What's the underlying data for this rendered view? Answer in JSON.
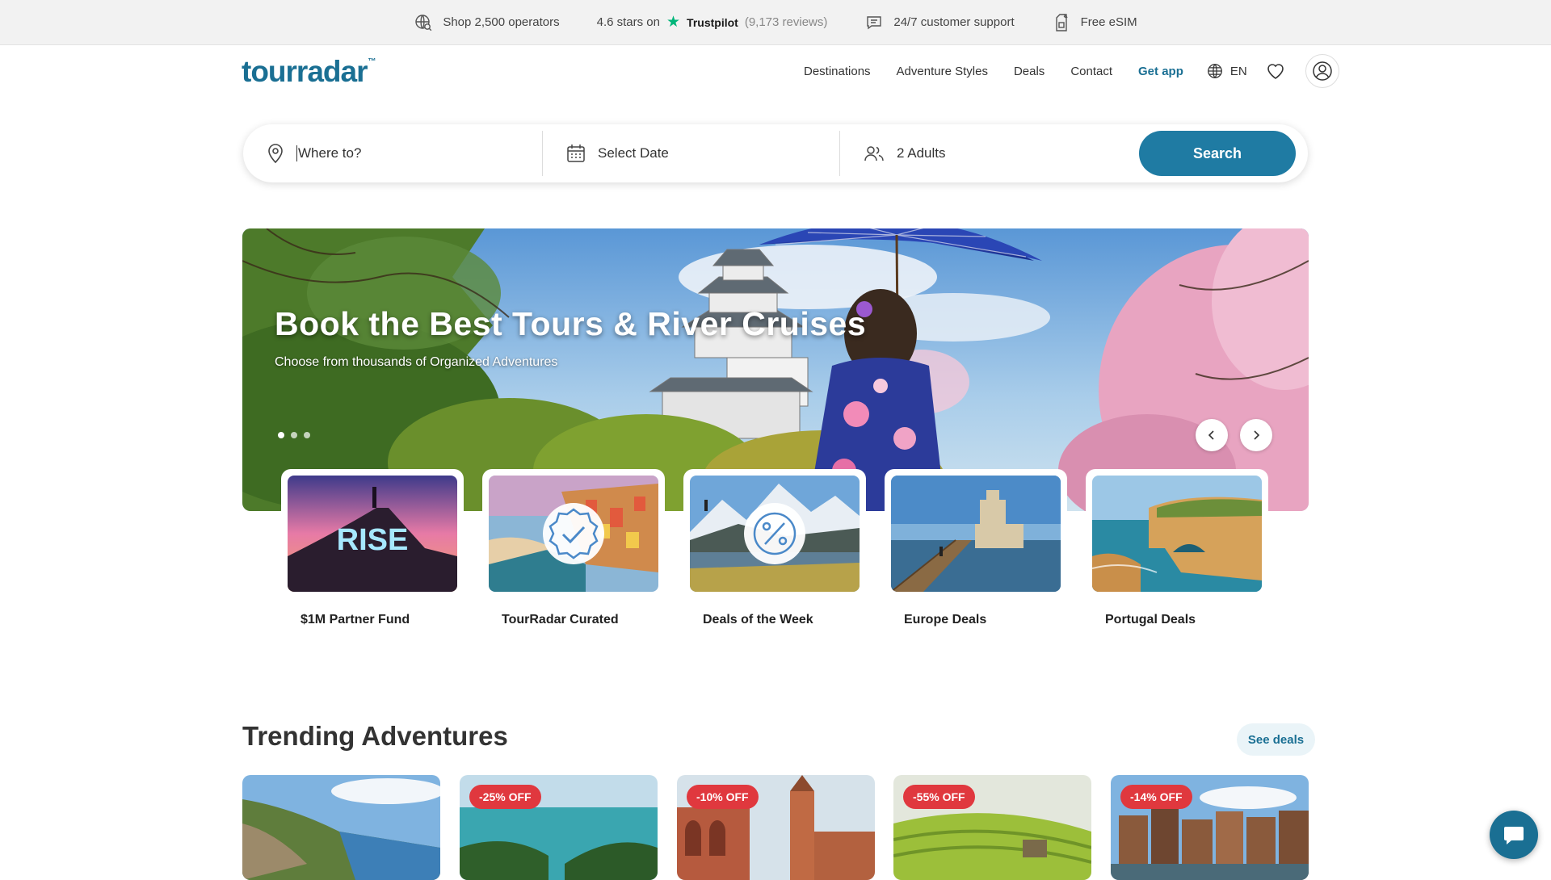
{
  "topbar": {
    "operators": "Shop 2,500 operators",
    "rating": "4.6 stars on",
    "trustpilot": "Trustpilot",
    "reviews": "(9,173 reviews)",
    "support": "24/7 customer support",
    "esim": "Free eSIM"
  },
  "header": {
    "logo": "tourradar",
    "logo_tm": "™",
    "nav": [
      "Destinations",
      "Adventure Styles",
      "Deals",
      "Contact"
    ],
    "get_app": "Get app",
    "language": "EN"
  },
  "search": {
    "where_placeholder": "Where to?",
    "date_label": "Select Date",
    "guests_label": "2 Adults",
    "button": "Search"
  },
  "hero": {
    "title": "Book the Best Tours & River Cruises",
    "subtitle": "Choose from thousands of Organized Adventures",
    "slide_count": 3,
    "active_slide": 1
  },
  "categories": [
    {
      "label": "$1M Partner Fund",
      "art_text": "RISE"
    },
    {
      "label": "TourRadar Curated"
    },
    {
      "label": "Deals of the Week"
    },
    {
      "label": "Europe Deals"
    },
    {
      "label": "Portugal Deals"
    }
  ],
  "trending": {
    "title": "Trending Adventures",
    "see_deals": "See deals",
    "badges": [
      "",
      "-25% OFF",
      "-10% OFF",
      "-55% OFF",
      "-14% OFF"
    ]
  },
  "colors": {
    "brand": "#1a6f93",
    "search_button": "#1f7ba3",
    "discount_badge": "#e0383e",
    "trustpilot_star": "#00b67a"
  }
}
